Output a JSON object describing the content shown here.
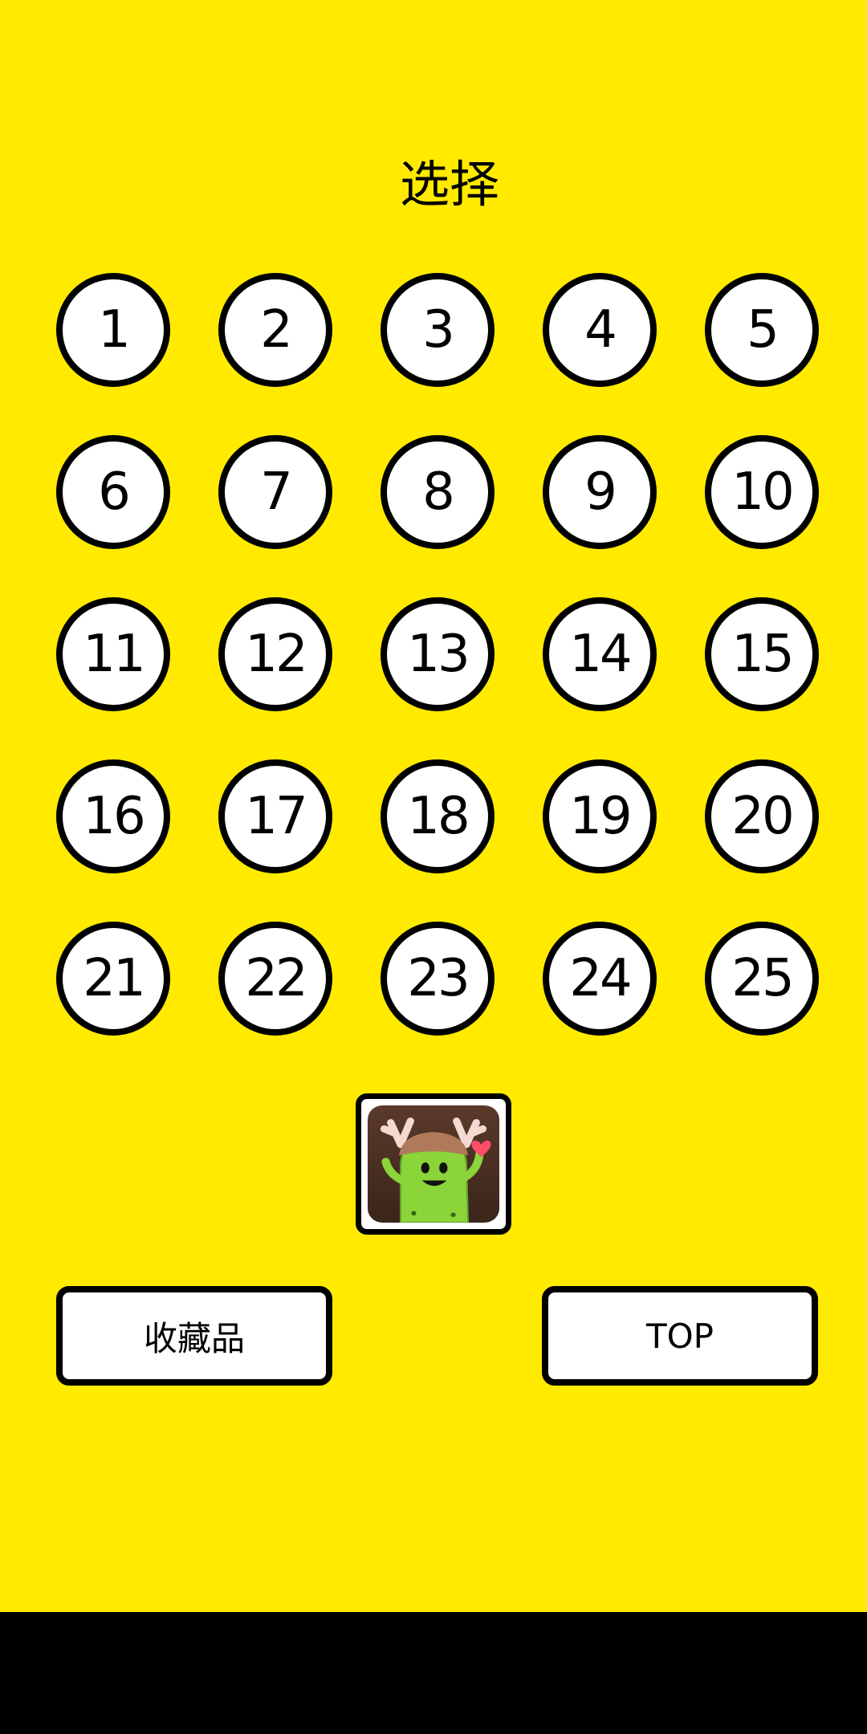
{
  "title": "选择",
  "levels": [
    "1",
    "2",
    "3",
    "4",
    "5",
    "6",
    "7",
    "8",
    "9",
    "10",
    "11",
    "12",
    "13",
    "14",
    "15",
    "16",
    "17",
    "18",
    "19",
    "20",
    "21",
    "22",
    "23",
    "24",
    "25"
  ],
  "buttons": {
    "collection": "收藏品",
    "top": "TOP"
  },
  "avatar_icon": "green-monster-with-antlers-icon",
  "colors": {
    "background": "#FFEA00",
    "button_fill": "#FFFFFF",
    "outline": "#000000",
    "nav_bar": "#000000"
  }
}
